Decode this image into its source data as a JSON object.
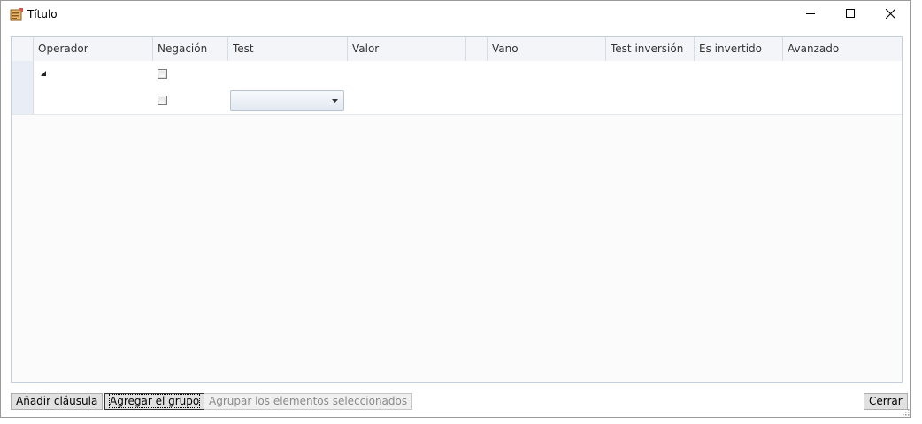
{
  "window": {
    "title": "Título",
    "icon": "form-app-icon",
    "controls": [
      "minimize-icon",
      "maximize-icon",
      "close-icon"
    ]
  },
  "grid": {
    "columns": [
      {
        "label": ""
      },
      {
        "label": "Operador"
      },
      {
        "label": "Negación"
      },
      {
        "label": "Test"
      },
      {
        "label": "Valor"
      },
      {
        "label": ""
      },
      {
        "label": "Vano"
      },
      {
        "label": "Test inversión"
      },
      {
        "label": "Es invertido"
      },
      {
        "label": "Avanzado"
      }
    ],
    "rows": [
      {
        "expander": "collapse-triangle-icon",
        "negation_checked": false,
        "test_value": ""
      },
      {
        "expander": "",
        "negation_checked": false,
        "test_value": ""
      }
    ]
  },
  "buttons": {
    "add_clause": "Añadir cláusula",
    "add_group": "Agregar el grupo",
    "group_selected": "Agrupar los elementos seleccionados",
    "close": "Cerrar"
  }
}
